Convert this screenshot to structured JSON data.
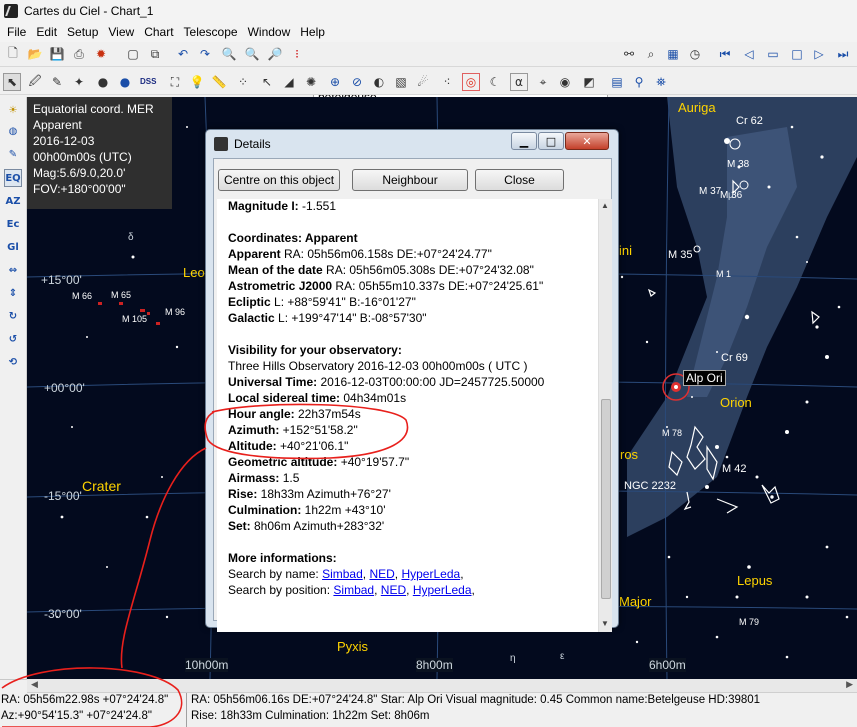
{
  "window": {
    "title": "Cartes du Ciel - Chart_1"
  },
  "menu": [
    "File",
    "Edit",
    "Setup",
    "View",
    "Chart",
    "Telescope",
    "Window",
    "Help"
  ],
  "search": {
    "value": "betelgeuse"
  },
  "toolbar2": {
    "dss_label": "DSS",
    "alpha_label": "α"
  },
  "leftbar": [
    "EQ",
    "AZ",
    "Ec",
    "Gl"
  ],
  "infobox": {
    "line1": "Equatorial coord. MER",
    "line2": "Apparent",
    "line3": "2016-12-03",
    "line4": "00h00m00s (UTC)",
    "line5": "Mag:5.6/9.0,20.0'",
    "line6": "FOV:+180°00'00\""
  },
  "chart": {
    "constellations": [
      "Auriga",
      "Orion",
      "Lepus",
      "Crater",
      "Pyxis",
      "Leo",
      "Major",
      "ros",
      "ini"
    ],
    "objects": [
      "Cr 62",
      "M 38",
      "M 37",
      "M 36",
      "M 35",
      "M 1",
      "Cr 69",
      "M 78",
      "M 42",
      "NGC 2232",
      "M 79",
      "M 66",
      "M 65",
      "M 105",
      "M 96"
    ],
    "selected_star": "Alp Ori",
    "dec_labels": [
      "+15°00'",
      "+00°00'",
      "-15°00'",
      "-30°00'"
    ],
    "ra_labels": [
      "10h00m",
      "8h00m",
      "6h00m"
    ],
    "greek": [
      "δ",
      "η",
      "ε",
      "μ"
    ]
  },
  "dialog": {
    "title": "Details",
    "buttons": {
      "centre": "Centre on this object",
      "neighbour": "Neighbour",
      "close": "Close"
    },
    "magnitude": {
      "label": "Magnitude I:",
      "value": " -1.551"
    },
    "coords_header": "Coordinates: Apparent",
    "apparent": {
      "label": "Apparent",
      "value": " RA: 05h56m06.158s DE:+07°24'24.77\""
    },
    "mean": {
      "label": "Mean of the date",
      "value": " RA: 05h56m05.308s DE:+07°24'32.08\""
    },
    "astrometric": {
      "label": "Astrometric J2000",
      "value": " RA: 05h55m10.337s DE:+07°24'25.61\""
    },
    "ecliptic": {
      "label": "Ecliptic",
      "value": "  L: +88°59'41\" B:-16°01'27\""
    },
    "galactic": {
      "label": "Galactic",
      "value": "  L: +199°47'14\" B:-08°57'30\""
    },
    "vis_header": "Visibility for your observatory:",
    "observatory": "Three Hills Observatory 2016-12-03 00h00m00s ( UTC )",
    "ut": {
      "label": "Universal Time:",
      "value": " 2016-12-03T00:00:00 JD=2457725.50000"
    },
    "lst": {
      "label": "Local sidereal time:",
      "value": " 04h34m01s"
    },
    "hour_angle": {
      "label": "Hour angle:",
      "value": " 22h37m54s"
    },
    "azimuth": {
      "label": "Azimuth:",
      "value": " +152°51'58.2\""
    },
    "altitude": {
      "label": "Altitude:",
      "value": " +40°21'06.1\""
    },
    "geo_alt": {
      "label": "Geometric altitude:",
      "value": " +40°19'57.7\""
    },
    "airmass": {
      "label": "Airmass:",
      "value": " 1.5"
    },
    "rise": {
      "label": "Rise:",
      "value": " 18h33m Azimuth+76°27'"
    },
    "culm": {
      "label": "Culmination:",
      "value": " 1h22m +43°10'"
    },
    "set": {
      "label": "Set:",
      "value": " 8h06m Azimuth+283°32'"
    },
    "more_header": "More informations:",
    "search_name": "Search by name: ",
    "search_pos": "Search by position: ",
    "links": {
      "simbad": "Simbad",
      "ned": "NED",
      "hyperleda": "HyperLeda",
      "comma": ","
    }
  },
  "status": {
    "left1": "RA: 05h56m22.98s +07°24'24.8\"",
    "left2": "Az:+90°54'15.3\" +07°24'24.8\"",
    "right1": "RA: 05h56m06.16s DE:+07°24'24.8\"  Star: Alp Ori  Visual magnitude:  0.45  Common name:Betelgeuse  HD:39801",
    "right2": "Rise: 18h33m   Culmination:  1h22m   Set:  8h06m"
  },
  "colors": {
    "constellation_label": "#ffd400",
    "annotation": "#e8201c",
    "link": "#0000ee"
  }
}
